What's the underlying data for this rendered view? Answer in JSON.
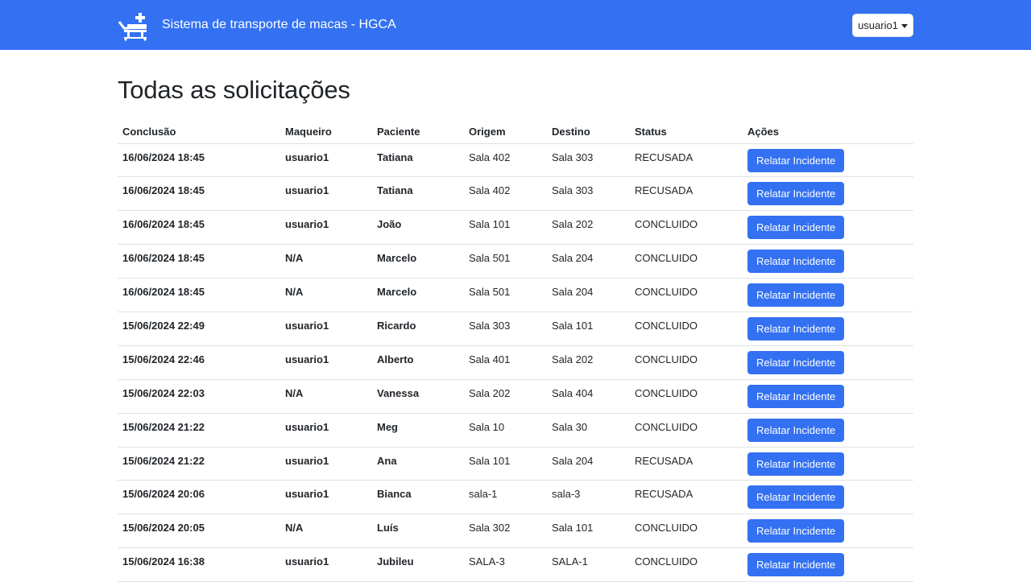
{
  "header": {
    "title": "Sistema de transporte de macas - HGCA",
    "user_menu": "usuario1",
    "logo_icon": "stretcher-plus-icon",
    "accent_color": "#3371f2"
  },
  "page": {
    "title": "Todas as solicitações"
  },
  "table": {
    "columns": [
      "Conclusão",
      "Maqueiro",
      "Paciente",
      "Origem",
      "Destino",
      "Status",
      "Ações"
    ],
    "action_label": "Relatar Incidente",
    "rows": [
      {
        "conclusao": "16/06/2024 18:45",
        "maqueiro": "usuario1",
        "paciente": "Tatiana",
        "origem": "Sala 402",
        "destino": "Sala 303",
        "status": "RECUSADA"
      },
      {
        "conclusao": "16/06/2024 18:45",
        "maqueiro": "usuario1",
        "paciente": "Tatiana",
        "origem": "Sala 402",
        "destino": "Sala 303",
        "status": "RECUSADA"
      },
      {
        "conclusao": "16/06/2024 18:45",
        "maqueiro": "usuario1",
        "paciente": "João",
        "origem": "Sala 101",
        "destino": "Sala 202",
        "status": "CONCLUIDO"
      },
      {
        "conclusao": "16/06/2024 18:45",
        "maqueiro": "N/A",
        "paciente": "Marcelo",
        "origem": "Sala 501",
        "destino": "Sala 204",
        "status": "CONCLUIDO"
      },
      {
        "conclusao": "16/06/2024 18:45",
        "maqueiro": "N/A",
        "paciente": "Marcelo",
        "origem": "Sala 501",
        "destino": "Sala 204",
        "status": "CONCLUIDO"
      },
      {
        "conclusao": "15/06/2024 22:49",
        "maqueiro": "usuario1",
        "paciente": "Ricardo",
        "origem": "Sala 303",
        "destino": "Sala 101",
        "status": "CONCLUIDO"
      },
      {
        "conclusao": "15/06/2024 22:46",
        "maqueiro": "usuario1",
        "paciente": "Alberto",
        "origem": "Sala 401",
        "destino": "Sala 202",
        "status": "CONCLUIDO"
      },
      {
        "conclusao": "15/06/2024 22:03",
        "maqueiro": "N/A",
        "paciente": "Vanessa",
        "origem": "Sala 202",
        "destino": "Sala 404",
        "status": "CONCLUIDO"
      },
      {
        "conclusao": "15/06/2024 21:22",
        "maqueiro": "usuario1",
        "paciente": "Meg",
        "origem": "Sala 10",
        "destino": "Sala 30",
        "status": "CONCLUIDO"
      },
      {
        "conclusao": "15/06/2024 21:22",
        "maqueiro": "usuario1",
        "paciente": "Ana",
        "origem": "Sala 101",
        "destino": "Sala 204",
        "status": "RECUSADA"
      },
      {
        "conclusao": "15/06/2024 20:06",
        "maqueiro": "usuario1",
        "paciente": "Bianca",
        "origem": "sala-1",
        "destino": "sala-3",
        "status": "RECUSADA"
      },
      {
        "conclusao": "15/06/2024 20:05",
        "maqueiro": "N/A",
        "paciente": "Luís",
        "origem": "Sala 302",
        "destino": "Sala 101",
        "status": "CONCLUIDO"
      },
      {
        "conclusao": "15/06/2024 16:38",
        "maqueiro": "usuario1",
        "paciente": "Jubileu",
        "origem": "SALA-3",
        "destino": "SALA-1",
        "status": "CONCLUIDO"
      }
    ]
  }
}
